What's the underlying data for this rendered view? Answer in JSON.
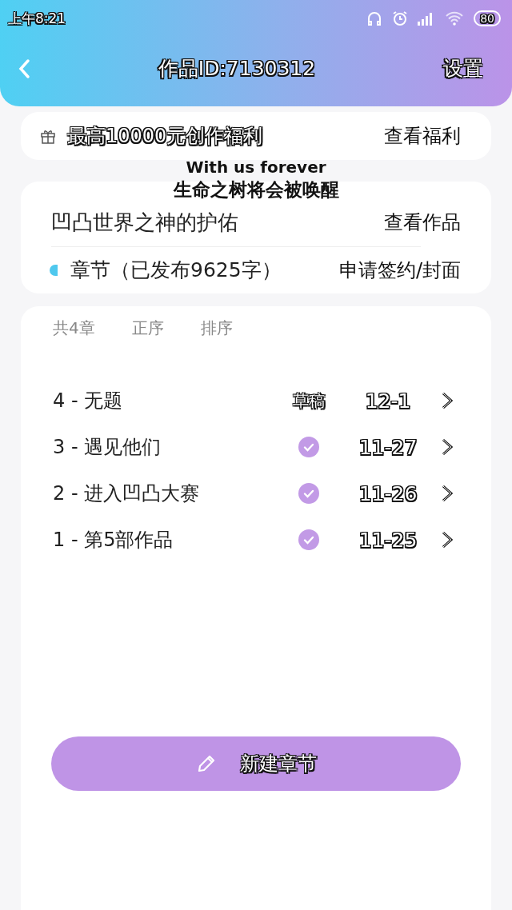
{
  "status_bar": {
    "time": "上午8:21",
    "battery": "80"
  },
  "header": {
    "title": "作品ID:7130312",
    "action": "设置"
  },
  "welfare": {
    "text": "最高10000元创作福利",
    "link": "查看福利"
  },
  "work": {
    "title": "凹凸世界之神的护佑",
    "link": "查看作品",
    "chapters_label": "章节（已发布9625字）",
    "chapters_link": "申请签约/封面"
  },
  "toolbar": {
    "count": "共4章",
    "items": [
      "正序",
      "排序"
    ]
  },
  "chapters": [
    {
      "title": "4 - 无题",
      "kind": "draft",
      "status": "草稿",
      "date": "12-1"
    },
    {
      "title": "3 - 遇见他们",
      "kind": "published",
      "date": "11-27"
    },
    {
      "title": "2 - 进入凹凸大赛",
      "kind": "published",
      "date": "11-26"
    },
    {
      "title": "1 - 第5部作品",
      "kind": "published",
      "date": "11-25"
    }
  ],
  "new_button": "新建章节",
  "overlays": [
    "With us forever",
    "生命之树将会被唤醒"
  ]
}
